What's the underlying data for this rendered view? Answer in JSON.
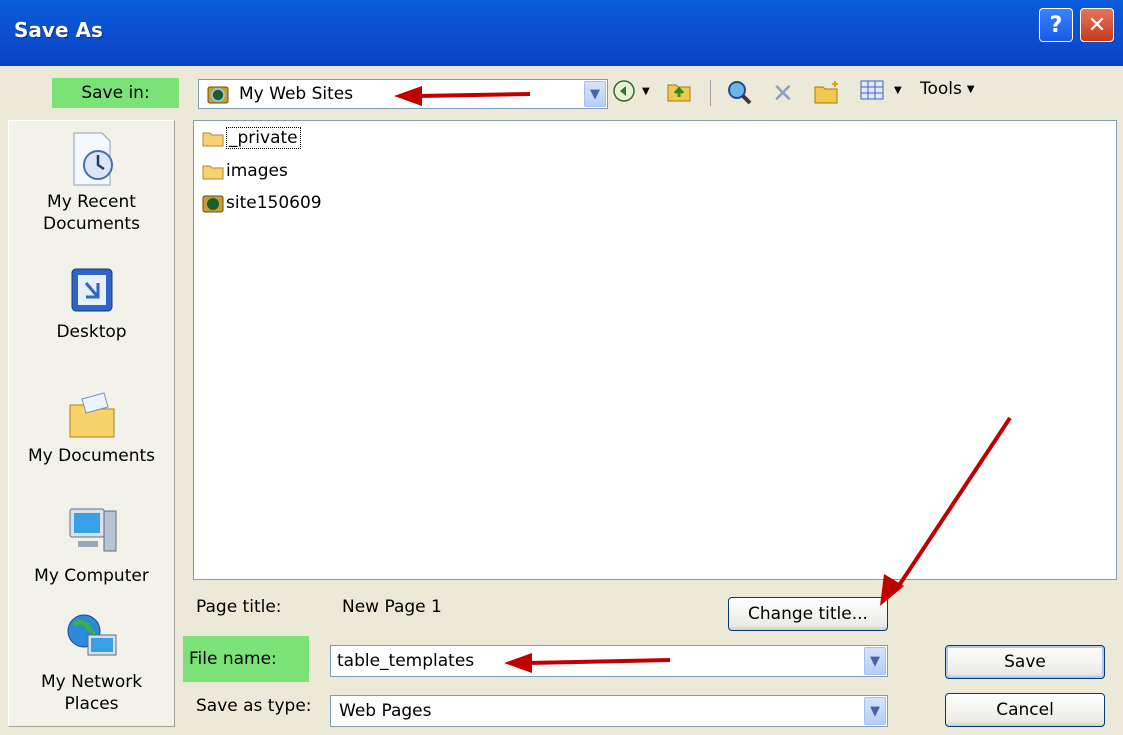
{
  "window": {
    "title": "Save As"
  },
  "header": {
    "save_in_label": "Save in:",
    "save_in_value": "My Web Sites",
    "tools_label": "Tools"
  },
  "places": [
    {
      "label_line1": "My Recent",
      "label_line2": "Documents",
      "icon": "recent-documents-icon"
    },
    {
      "label_line1": "Desktop",
      "label_line2": "",
      "icon": "desktop-icon"
    },
    {
      "label_line1": "My Documents",
      "label_line2": "",
      "icon": "my-documents-icon"
    },
    {
      "label_line1": "My Computer",
      "label_line2": "",
      "icon": "my-computer-icon"
    },
    {
      "label_line1": "My Network",
      "label_line2": "Places",
      "icon": "network-places-icon"
    }
  ],
  "files": [
    {
      "name": "_private",
      "type": "folder"
    },
    {
      "name": "images",
      "type": "folder"
    },
    {
      "name": "site150609",
      "type": "web-site"
    }
  ],
  "form": {
    "page_title_label": "Page title:",
    "page_title_value": "New Page 1",
    "change_title_label": "Change title...",
    "file_name_label": "File name:",
    "file_name_value": "table_templates",
    "save_as_type_label": "Save as type:",
    "save_as_type_value": "Web Pages",
    "save_label": "Save",
    "cancel_label": "Cancel"
  },
  "colors": {
    "title_bar": "#0a50d0",
    "highlight": "#7ae276",
    "annotation_arrow": "#c00000",
    "dialog_bg": "#ece9d8"
  }
}
